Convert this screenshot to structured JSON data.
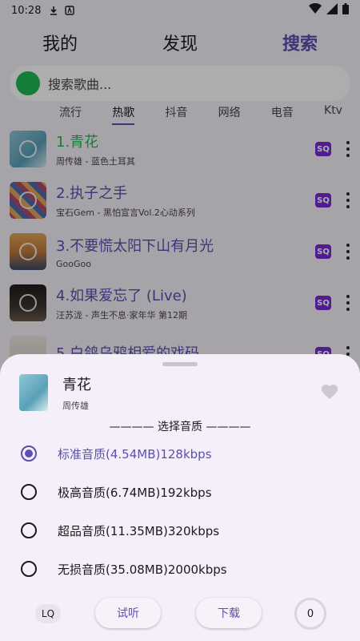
{
  "status": {
    "time": "10:28"
  },
  "top_tabs": [
    {
      "label": "我的",
      "active": false
    },
    {
      "label": "发现",
      "active": false
    },
    {
      "label": "搜索",
      "active": true
    }
  ],
  "search": {
    "placeholder": "搜索歌曲..."
  },
  "category_tabs": [
    "流行",
    "热歌",
    "抖音",
    "网络",
    "电音",
    "Ktv"
  ],
  "category_active": "热歌",
  "songs": [
    {
      "title": "1.青花",
      "subtitle": "周传雄 - 蓝色土耳其",
      "badge": "SQ",
      "playing": true,
      "cover_color": "#5aa0b8"
    },
    {
      "title": "2.执子之手",
      "subtitle": "宝石Gem - 黑怕宣言Vol.2心动系列",
      "badge": "SQ",
      "playing": false,
      "cover_color": "#b04a6a"
    },
    {
      "title": "3.不要慌太阳下山有月光",
      "subtitle": "GooGoo",
      "badge": "SQ",
      "playing": false,
      "cover_color": "#c27a3a"
    },
    {
      "title": "4.如果爱忘了 (Live)",
      "subtitle": "汪苏泷 - 声生不息·家年华 第12期",
      "badge": "SQ",
      "playing": false,
      "cover_color": "#3a3530"
    },
    {
      "title": "5.白鸽乌鸦相爱的戏码",
      "subtitle": "",
      "badge": "SQ",
      "playing": false,
      "cover_color": "#d8cfc6"
    }
  ],
  "sheet": {
    "title": "青花",
    "artist": "周传雄",
    "quality_heading": "———— 选择音质 ————",
    "options": [
      {
        "label": "标准音质(4.54MB)128kbps",
        "selected": true
      },
      {
        "label": "极高音质(6.74MB)192kbps",
        "selected": false
      },
      {
        "label": "超品音质(11.35MB)320kbps",
        "selected": false
      },
      {
        "label": "无损音质(35.08MB)2000kbps",
        "selected": false
      }
    ],
    "lq_label": "LQ",
    "listen_label": "试听",
    "download_label": "下载",
    "counter": "0"
  },
  "colors": {
    "accent": "#5b4fb0",
    "playing": "#1db954",
    "badge": "#7a2bd6"
  }
}
